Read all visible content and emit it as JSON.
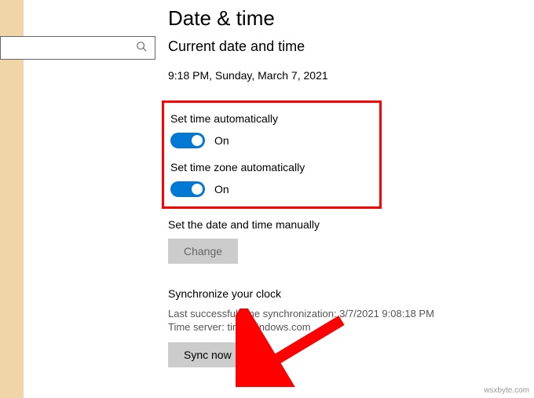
{
  "search": {
    "placeholder": ""
  },
  "page": {
    "title": "Date & time",
    "subtitle": "Current date and time",
    "current_datetime": "9:18 PM, Sunday, March 7, 2021"
  },
  "auto_time": {
    "label": "Set time automatically",
    "state": "On"
  },
  "auto_tz": {
    "label": "Set time zone automatically",
    "state": "On"
  },
  "manual": {
    "label": "Set the date and time manually",
    "button": "Change"
  },
  "sync": {
    "title": "Synchronize your clock",
    "last": "Last successful time synchronization: 3/7/2021 9:08:18 PM",
    "server": "Time server: time.windows.com",
    "button": "Sync now"
  },
  "watermark": "wsxbyte.com",
  "colors": {
    "accent": "#0078d4",
    "highlight": "#ff0000"
  }
}
